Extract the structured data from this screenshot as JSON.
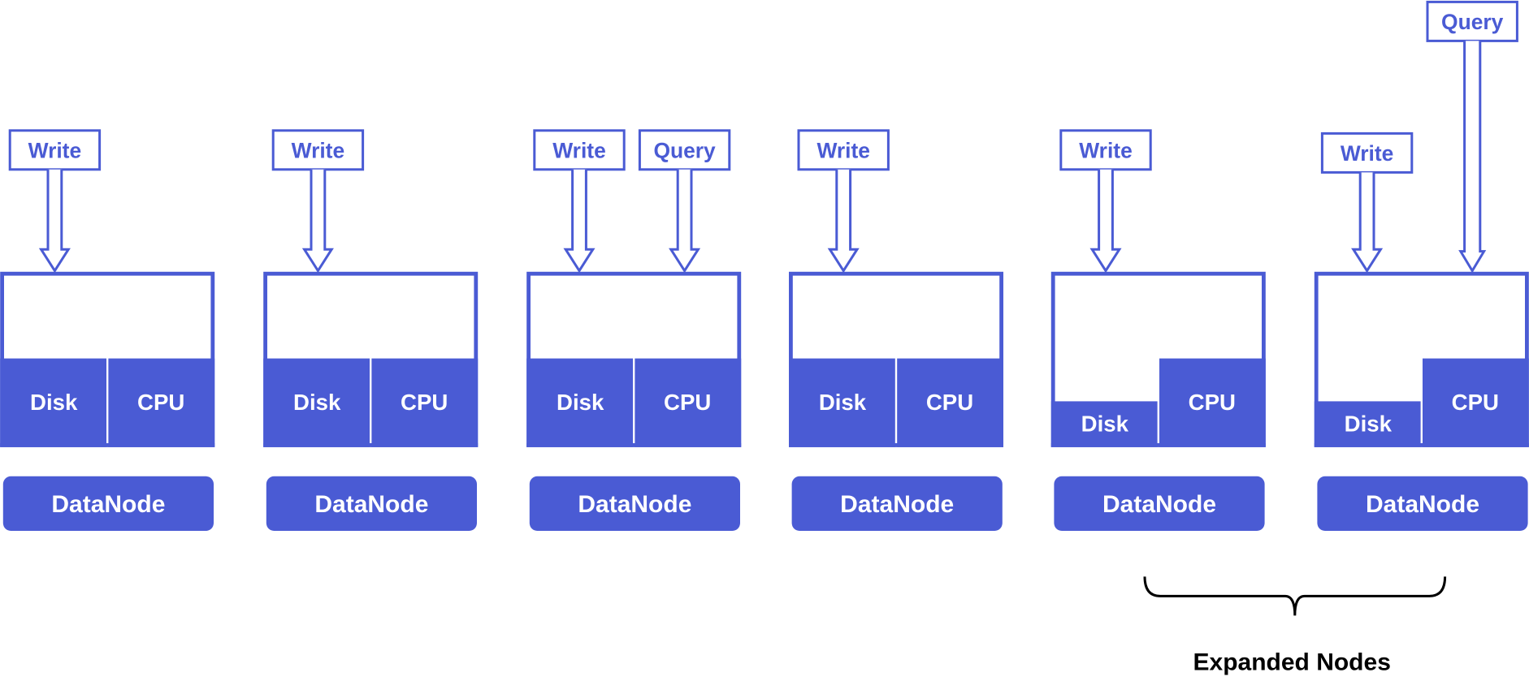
{
  "colors": {
    "accent": "#4a5bd4",
    "background": "#ffffff",
    "text_dark": "#000000"
  },
  "nodes": [
    {
      "label": "DataNode",
      "disk": "Disk",
      "cpu": "CPU",
      "disk_reduced": false,
      "arrows": [
        {
          "label": "Write",
          "tall": false
        }
      ]
    },
    {
      "label": "DataNode",
      "disk": "Disk",
      "cpu": "CPU",
      "disk_reduced": false,
      "arrows": [
        {
          "label": "Write",
          "tall": false
        }
      ]
    },
    {
      "label": "DataNode",
      "disk": "Disk",
      "cpu": "CPU",
      "disk_reduced": false,
      "arrows": [
        {
          "label": "Write",
          "tall": false
        },
        {
          "label": "Query",
          "tall": false
        }
      ]
    },
    {
      "label": "DataNode",
      "disk": "Disk",
      "cpu": "CPU",
      "disk_reduced": false,
      "arrows": [
        {
          "label": "Write",
          "tall": false
        }
      ]
    },
    {
      "label": "DataNode",
      "disk": "Disk",
      "cpu": "CPU",
      "disk_reduced": true,
      "arrows": [
        {
          "label": "Write",
          "tall": false
        }
      ]
    },
    {
      "label": "DataNode",
      "disk": "Disk",
      "cpu": "CPU",
      "disk_reduced": true,
      "arrows": [
        {
          "label": "Write",
          "tall": false
        },
        {
          "label": "Query",
          "tall": true
        }
      ]
    }
  ],
  "brace_label": "Expanded Nodes"
}
